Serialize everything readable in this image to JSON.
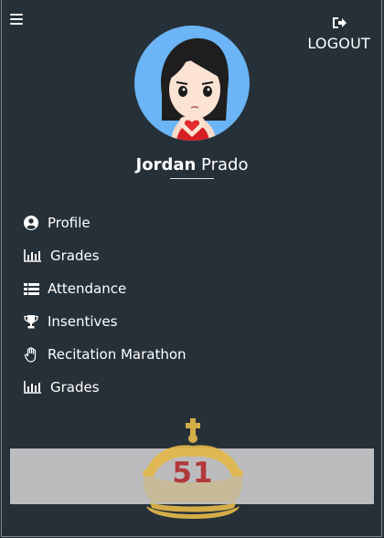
{
  "header": {
    "menu_icon": "hamburger-icon",
    "logout_label": "LOGOUT",
    "logout_icon": "sign-out-icon"
  },
  "profile": {
    "first_name": "Jordan",
    "last_name": "Prado",
    "avatar_bg": "#6bb4f5"
  },
  "nav": {
    "items": [
      {
        "label": "Profile",
        "icon": "user-circle-icon"
      },
      {
        "label": "Grades",
        "icon": "bar-chart-icon"
      },
      {
        "label": "Attendance",
        "icon": "list-icon"
      },
      {
        "label": "Insentives",
        "icon": "trophy-icon"
      },
      {
        "label": "Recitation Marathon",
        "icon": "raised-hand-icon"
      },
      {
        "label": "Grades",
        "icon": "bar-chart-icon"
      }
    ]
  },
  "score": {
    "value": "51",
    "icon": "crown-icon",
    "value_color": "#b2393a",
    "crown_color": "#e2b84a"
  },
  "colors": {
    "background": "#263038",
    "text": "#ffffff",
    "banner": "#bcbcbe"
  }
}
